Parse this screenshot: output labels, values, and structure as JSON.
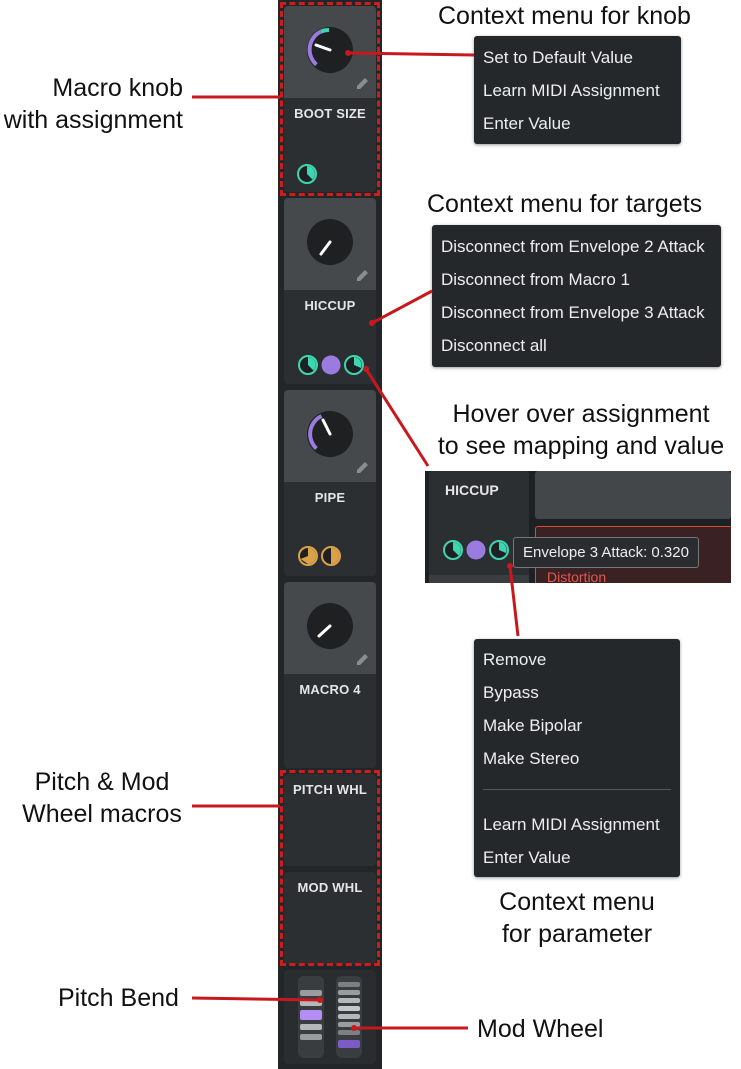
{
  "annotations": {
    "macro_knob": [
      "Macro knob",
      "with assignment"
    ],
    "context_menu_knob": "Context menu for knob",
    "context_menu_targets": "Context menu for targets",
    "hover_over": [
      "Hover over assignment",
      "to see mapping and value"
    ],
    "pitch_mod": [
      "Pitch & Mod",
      "Wheel macros"
    ],
    "context_menu_param": [
      "Context menu",
      "for parameter"
    ],
    "pitch_bend": "Pitch Bend",
    "mod_wheel": "Mod Wheel"
  },
  "macros": [
    {
      "label": "BOOT SIZE"
    },
    {
      "label": "HICCUP"
    },
    {
      "label": "PIPE"
    },
    {
      "label": "MACRO 4"
    },
    {
      "label": "PITCH WHL"
    },
    {
      "label": "MOD WHL"
    }
  ],
  "knob_menu": [
    "Set to Default Value",
    "Learn MIDI Assignment",
    "Enter Value"
  ],
  "targets_menu": [
    "Disconnect from Envelope 2 Attack",
    "Disconnect from Macro 1",
    "Disconnect from Envelope 3 Attack",
    "Disconnect all"
  ],
  "param_menu": [
    "Remove",
    "Bypass",
    "Make Bipolar",
    "Make Stereo",
    "Learn MIDI Assignment",
    "Enter Value"
  ],
  "hover_inset": {
    "label": "HICCUP",
    "tooltip": "Envelope 3 Attack: 0.320",
    "partial_label": "Distortion"
  },
  "colors": {
    "teal": "#3ed6b0",
    "purple": "#9a7be0",
    "orange": "#d9a24a",
    "red": "#c8181e"
  }
}
